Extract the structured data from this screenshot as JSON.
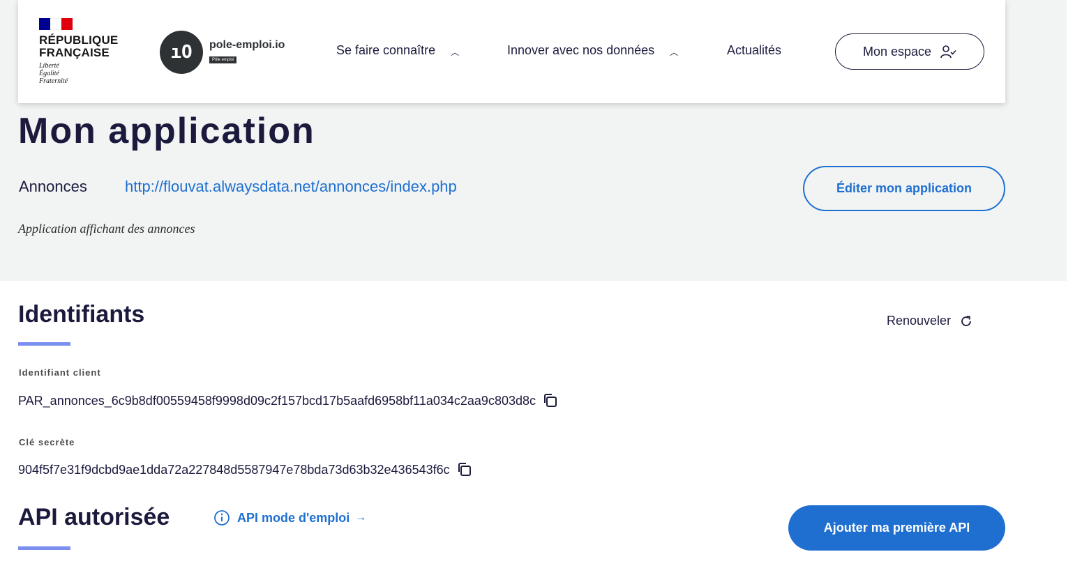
{
  "header": {
    "republique": {
      "name": "RÉPUBLIQUE\nFRANÇAISE",
      "motto": "Liberté\nÉgalité\nFraternité"
    },
    "brand": {
      "logo_mark": "ıO",
      "name": "pole-emploi.io",
      "tag": "Pôle emploi"
    },
    "nav": [
      {
        "label": "Se faire connaître",
        "icon": "chevron-up-icon"
      },
      {
        "label": "Innover avec nos données",
        "icon": "chevron-up-icon"
      },
      {
        "label": "Actualités"
      }
    ],
    "account_button": {
      "label": "Mon espace",
      "icon": "user-check-icon"
    }
  },
  "application": {
    "title": "Mon application",
    "name": "Annonces",
    "url": "http://flouvat.alwaysdata.net/annonces/index.php",
    "description": "Application affichant des annonces",
    "edit_button": "Éditer mon application"
  },
  "credentials": {
    "title": "Identifiants",
    "renew_label": "Renouveler",
    "client_id_label": "Identifiant client",
    "client_id": "PAR_annonces_6c9b8df00559458f9998d09c2f157bcd17b5aafd6958bf11a034c2aa9c803d8c",
    "secret_label": "Clé secrète",
    "secret": "904f5f7e31f9dcbd9ae1dda72a227848d5587947e78bda73d63b32e436543f6c"
  },
  "api": {
    "title": "API autorisée",
    "doc_link": "API mode d'emploi",
    "add_button": "Ajouter ma première API"
  },
  "colors": {
    "primary": "#1f6fd1",
    "navy": "#1b1a3d",
    "band": "#f1f4f3",
    "accent_underline": "#7b8ff0"
  }
}
